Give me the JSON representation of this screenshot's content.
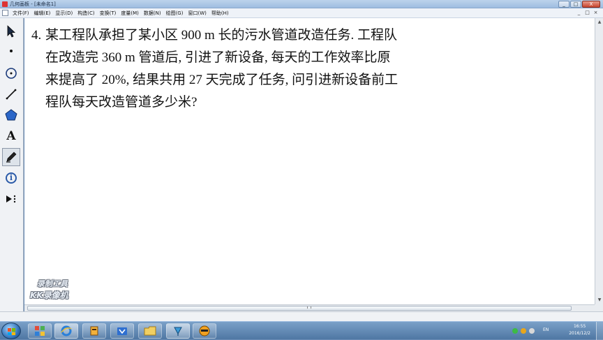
{
  "window": {
    "title": "几何画板 - [未命名1]",
    "controls": [
      "_",
      "□",
      "X"
    ]
  },
  "menubar": {
    "items": [
      "文件(F)",
      "编辑(E)",
      "显示(D)",
      "构造(C)",
      "变换(T)",
      "度量(M)",
      "数据(N)",
      "绘图(G)",
      "窗口(W)",
      "帮助(H)"
    ],
    "doc_controls": [
      "_",
      "□",
      "×"
    ]
  },
  "toolbox": {
    "tools": [
      {
        "name": "arrow-select",
        "icon": "arrow-icon"
      },
      {
        "name": "point",
        "icon": "point-icon"
      },
      {
        "name": "compass",
        "icon": "circle-icon"
      },
      {
        "name": "straightedge",
        "icon": "line-icon"
      },
      {
        "name": "polygon",
        "icon": "polygon-icon"
      },
      {
        "name": "text",
        "icon": "text-icon",
        "glyph": "A"
      },
      {
        "name": "marker",
        "icon": "pen-icon",
        "selected": true
      },
      {
        "name": "information",
        "icon": "info-icon",
        "glyph": "i"
      },
      {
        "name": "custom",
        "icon": "custom-tool-icon"
      }
    ]
  },
  "problem": {
    "number": "4.",
    "lines": [
      "某工程队承担了某小区 900 m 长的污水管道改造任务. 工程队",
      "在改造完 360 m 管道后, 引进了新设备, 每天的工作效率比原",
      "来提高了 20%, 结果共用 27 天完成了任务, 问引进新设备前工",
      "程队每天改造管道多少米?"
    ]
  },
  "watermark": {
    "line1": "录制工具",
    "line2": "KK录像机"
  },
  "taskbar": {
    "tasks": [
      "ie-icon",
      "app-icon",
      "folder-icon",
      "sketchpad-icon",
      "recorder-icon"
    ],
    "language": "EN",
    "clock_time": "16:55",
    "clock_date": "2016/12/2"
  },
  "colors": {
    "canvas": "#ffffff",
    "toolbox": "#f0f2f5",
    "taskbar": "#5a82ad",
    "titlebar": "#bcd3ec",
    "info_tool": "#2a5aa8"
  }
}
